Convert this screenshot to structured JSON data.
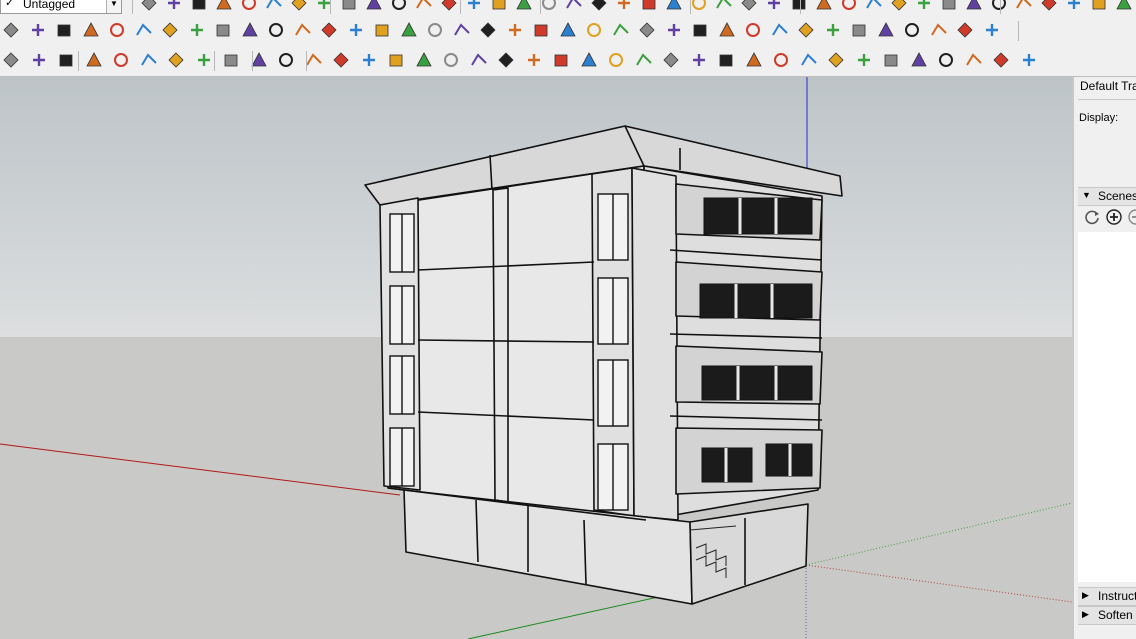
{
  "toolbar": {
    "tag_select": {
      "check": "✓",
      "value": "Untagged"
    },
    "row1_icons": [
      "select-tool-icon",
      "eraser-icon",
      "line-tool-icon",
      "arc-tool-icon",
      "shape-tool-icon",
      "push-pull-icon",
      "move-icon",
      "rotate-icon",
      "scale-icon",
      "offset-icon",
      "tape-measure-icon",
      "dimension-icon",
      "protractor-icon",
      "text-tool-icon",
      "axes-icon",
      "3d-text-icon",
      "orbit-icon",
      "pan-icon",
      "zoom-icon",
      "zoom-window-icon",
      "zoom-extents-icon",
      "walk-icon",
      "look-around-icon",
      "position-camera-icon",
      "section-plane-icon",
      "section-display-icon",
      "paint-bucket-icon",
      "follow-me-icon",
      "intersect-icon",
      "union-icon",
      "subtract-icon",
      "trim-icon",
      "split-icon",
      "solid-tools-icon",
      "outer-shell-icon",
      "iso-view-icon",
      "top-view-icon",
      "front-view-icon",
      "right-view-icon",
      "back-view-icon",
      "left-view-icon",
      "bottom-view-icon",
      "xray-icon",
      "back-edges-icon",
      "wireframe-icon",
      "hidden-line-icon",
      "shaded-icon",
      "textured-icon"
    ],
    "row2_icons": [
      "warehouse-icon",
      "share-component-icon",
      "extension-warehouse-icon",
      "layout-icon",
      "style-builder-icon",
      "sandbox-from-contours-icon",
      "sandbox-from-scratch-icon",
      "smoove-icon",
      "stamp-icon",
      "drape-icon",
      "add-detail-icon",
      "flip-edge-icon",
      "red-cube-icon",
      "grid-icon",
      "table-icon",
      "flag-icon",
      "curve-icon",
      "spline-icon",
      "plus-tool-icon",
      "move-cross-icon",
      "diamond-icon",
      "cone-icon",
      "warning-icon",
      "lasso-icon",
      "knot-icon",
      "loop-icon",
      "cylinder-icon",
      "undo-curve-icon",
      "puzzle-icon",
      "cubes-icon",
      "component-array-icon",
      "tools-icon",
      "hexagon-icon",
      "joint-push-pull-icon",
      "grid-cells-icon",
      "scatter-icon",
      "map-icon",
      "dots-icon"
    ],
    "row3_icons": [
      "reload-icon",
      "refresh-icon",
      "layer-manager-icon",
      "add-circle-icon",
      "tree-icon",
      "landscape-icon",
      "checker-icon",
      "cloud-upload-icon",
      "settings-gear-icon",
      "mail-icon",
      "info-icon",
      "curve-1-icon",
      "curve-2-icon",
      "paint-icon",
      "slash-icon",
      "gear-small-icon",
      "shape-icon",
      "swirl-icon",
      "box-icon",
      "sphere-icon",
      "path-icon",
      "offset-line-icon",
      "fillet-icon",
      "chamfer-icon",
      "taper-icon",
      "bridge-icon",
      "loft-icon",
      "rail-icon",
      "grid-lines-icon",
      "crown-icon",
      "lamp-icon",
      "arrows-icon",
      "lines-icon",
      "hatch-icon",
      "curves-icon",
      "ramp-icon",
      "bend-icon",
      "slice-icon"
    ]
  },
  "tray": {
    "title": "Default Tray",
    "display_label": "Display:",
    "scenes_label": "Scenes",
    "instructor_label": "Instructor",
    "soften_label": "Soften Edges",
    "scene_tool_icons": [
      "refresh-scenes-icon",
      "add-scene-icon",
      "remove-scene-icon"
    ]
  },
  "viewport": {
    "sky_color": "#cbcfd1",
    "ground_color": "#c9c9c7",
    "model_fill": "#e5e5e5",
    "edge_color": "#111111"
  }
}
